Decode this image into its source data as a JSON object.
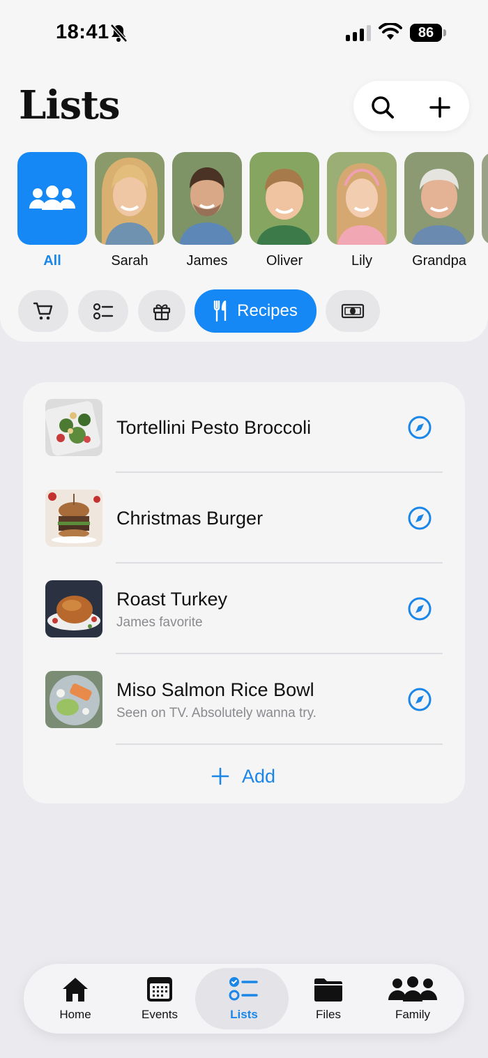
{
  "status_bar": {
    "time": "18:41",
    "battery": "86"
  },
  "header": {
    "title": "Lists"
  },
  "people": [
    {
      "name": "All"
    },
    {
      "name": "Sarah"
    },
    {
      "name": "James"
    },
    {
      "name": "Oliver"
    },
    {
      "name": "Lily"
    },
    {
      "name": "Grandpa"
    }
  ],
  "categories": {
    "active_label": "Recipes",
    "items": [
      "cart-icon",
      "checklist-icon",
      "gift-icon",
      "fork-knife-icon",
      "money-icon"
    ]
  },
  "recipes": [
    {
      "title": "Tortellini Pesto Broccoli",
      "note": ""
    },
    {
      "title": "Christmas Burger",
      "note": ""
    },
    {
      "title": "Roast Turkey",
      "note": "James favorite"
    },
    {
      "title": "Miso Salmon Rice Bowl",
      "note": "Seen on TV. Absolutely wanna try."
    }
  ],
  "add_label": "Add",
  "tabs": [
    {
      "label": "Home",
      "icon": "house-icon"
    },
    {
      "label": "Events",
      "icon": "calendar-icon"
    },
    {
      "label": "Lists",
      "icon": "checklist-icon",
      "active": true
    },
    {
      "label": "Files",
      "icon": "folder-icon"
    },
    {
      "label": "Family",
      "icon": "people-icon"
    }
  ],
  "colors": {
    "accent": "#1588f5",
    "background": "#ebebef",
    "card": "#f5f5f6"
  }
}
